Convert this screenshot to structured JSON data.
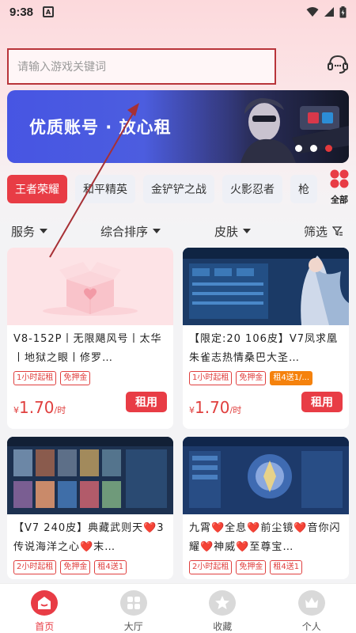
{
  "status_bar": {
    "time": "9:38",
    "notification_letter": "A"
  },
  "search": {
    "placeholder": "请输入游戏关键词"
  },
  "banner": {
    "headline": "优质账号 · 放心租",
    "dots": 3,
    "active_dot": 3
  },
  "game_tabs": [
    {
      "label": "王者荣耀",
      "active": true
    },
    {
      "label": "和平精英",
      "active": false
    },
    {
      "label": "金铲铲之战",
      "active": false
    },
    {
      "label": "火影忍者",
      "active": false
    },
    {
      "label": "枪",
      "active": false
    }
  ],
  "all_games_label": "全部",
  "filters": {
    "service": "服务",
    "sort": "综合排序",
    "skin": "皮肤",
    "filter": "筛选"
  },
  "listings": [
    {
      "title": "V8-152P丨无限飓风号丨太华丨地狱之眼丨修罗…",
      "tags": [
        "1小时起租",
        "免押金"
      ],
      "price_symbol": "¥",
      "price": "1.70",
      "price_unit": "/时",
      "button": "租用"
    },
    {
      "title": "【限定:20 106皮】V7凤求凰朱雀志热情桑巴大圣…",
      "tags": [
        "1小时起租",
        "免押金",
        "租4送1/..."
      ],
      "price_symbol": "¥",
      "price": "1.70",
      "price_unit": "/时",
      "button": "租用"
    },
    {
      "title": "【V7 240皮】典藏武则天❤️3传说海洋之心❤️末…",
      "tags": [
        "2小时起租",
        "免押金",
        "租4送1"
      ]
    },
    {
      "title": "九霄❤️全息❤️前尘镜❤️音你闪耀❤️神威❤️至尊宝…",
      "tags": [
        "2小时起租",
        "免押金",
        "租4送1"
      ]
    }
  ],
  "bottom_nav": [
    {
      "label": "首页",
      "active": true
    },
    {
      "label": "大厅",
      "active": false
    },
    {
      "label": "收藏",
      "active": false
    },
    {
      "label": "个人",
      "active": false
    }
  ],
  "colors": {
    "accent": "#e83c45",
    "tag_orange": "#f5820d",
    "search_highlight_border": "#b8343a"
  }
}
